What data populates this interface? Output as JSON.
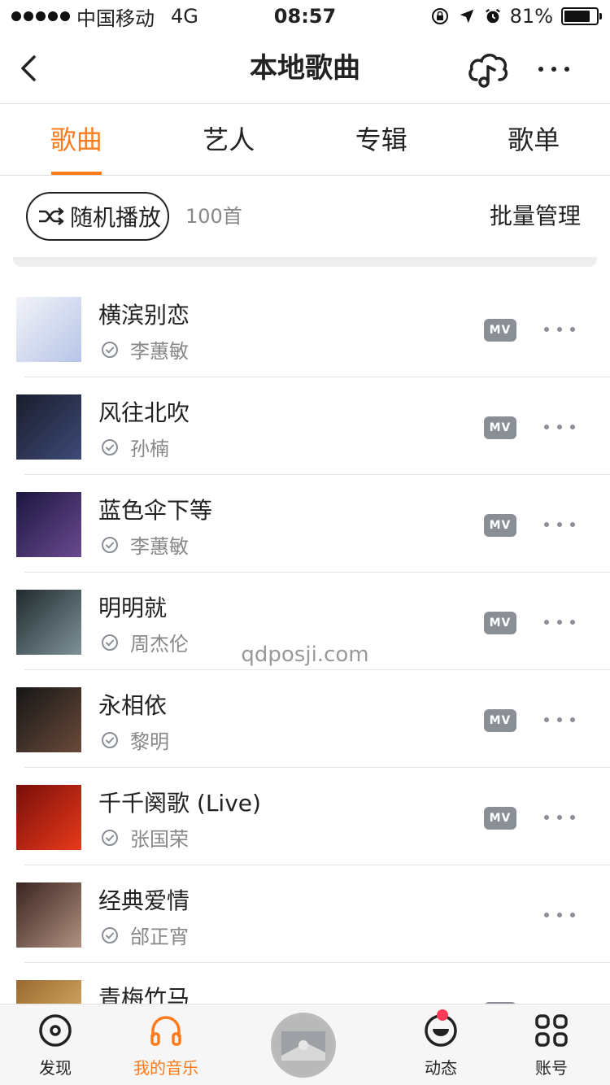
{
  "status_bar": {
    "carrier": "中国移动",
    "network": "4G",
    "time": "08:57",
    "battery": "81%",
    "battery_level": 0.81
  },
  "nav": {
    "title": "本地歌曲"
  },
  "tabs": [
    {
      "label": "歌曲",
      "active": true
    },
    {
      "label": "艺人",
      "active": false
    },
    {
      "label": "专辑",
      "active": false
    },
    {
      "label": "歌单",
      "active": false
    }
  ],
  "actions": {
    "shuffle_label": "随机播放",
    "count": "100首",
    "batch_label": "批量管理"
  },
  "songs": [
    {
      "title": "横滨别恋",
      "artist": "李蕙敏",
      "mv": "MV",
      "cover_colors": [
        "#f2f4f8",
        "#b7c4e8"
      ]
    },
    {
      "title": "风往北吹",
      "artist": "孙楠",
      "mv": "MV",
      "cover_colors": [
        "#1a1d2c",
        "#3e4a78"
      ]
    },
    {
      "title": "蓝色伞下等",
      "artist": "李蕙敏",
      "mv": "MV",
      "cover_colors": [
        "#1c1640",
        "#6a4a90"
      ]
    },
    {
      "title": "明明就",
      "artist": "周杰伦",
      "mv": "MV",
      "cover_colors": [
        "#1f2a2e",
        "#7f9298"
      ]
    },
    {
      "title": "永相依",
      "artist": "黎明",
      "mv": "MV",
      "cover_colors": [
        "#161616",
        "#6a4a3a"
      ]
    },
    {
      "title": "千千阕歌 (Live)",
      "artist": "张国荣",
      "mv": "MV",
      "cover_colors": [
        "#7a0e0a",
        "#e83a1a"
      ]
    },
    {
      "title": "经典爱情",
      "artist": "邰正宵",
      "mv": "",
      "cover_colors": [
        "#3a2420",
        "#b09080"
      ]
    },
    {
      "title": "青梅竹马",
      "artist": "",
      "mv": "MV",
      "cover_colors": [
        "#9a6a30",
        "#e0b870"
      ]
    }
  ],
  "watermark": "qdposji.com",
  "tabbar": [
    {
      "label": "发现",
      "icon": "disc-icon",
      "active": false
    },
    {
      "label": "我的音乐",
      "icon": "headphones-icon",
      "active": true
    },
    {
      "label": "",
      "icon": "now-playing-disc",
      "active": false
    },
    {
      "label": "动态",
      "icon": "smile-icon",
      "active": false
    },
    {
      "label": "账号",
      "icon": "grid-icon",
      "active": false
    }
  ],
  "colors": {
    "accent": "#ff7a1a",
    "badge": "#ff3b58",
    "mv_badge": "#8a8f96"
  }
}
